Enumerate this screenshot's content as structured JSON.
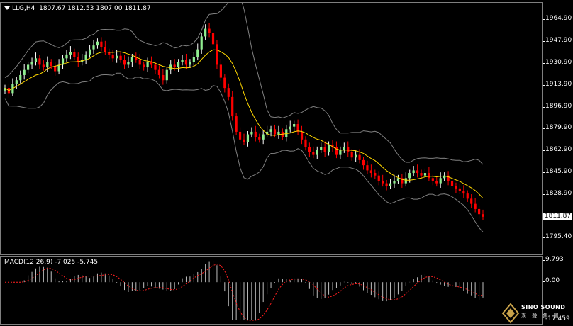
{
  "chart_header": {
    "symbol_tf": "LLG,H4",
    "ohlc": "1807.67 1812.53 1807.00 1811.87"
  },
  "macd_header": {
    "label": "MACD(12,26,9) -7.025 -5.745"
  },
  "price_axis": [
    "1964.90",
    "1947.90",
    "1930.90",
    "1913.90",
    "1896.90",
    "1879.90",
    "1862.90",
    "1845.90",
    "1828.90",
    "1811.87",
    "1795.40"
  ],
  "current_price": "1811.87",
  "macd_axis": [
    "9.793",
    "0.00",
    "-17.459"
  ],
  "logo": {
    "title": "SINO SOUND",
    "subtitle": "漢 聲 集 團"
  },
  "colors": {
    "bull": "#ffffff",
    "bear": "#ff0000",
    "bull_body": "#90ee90",
    "bear_body": "#ff0000",
    "ma": "#ffd700",
    "band": "#808080",
    "signal": "#ff2020"
  },
  "chart_data": {
    "type": "candlestick",
    "symbol": "LLG",
    "timeframe": "H4",
    "ylim": [
      1795.4,
      1970
    ],
    "closes": [
      1912,
      1908,
      1915,
      1918,
      1922,
      1926,
      1930,
      1932,
      1935,
      1930,
      1928,
      1932,
      1929,
      1925,
      1930,
      1935,
      1938,
      1940,
      1936,
      1932,
      1934,
      1938,
      1942,
      1945,
      1948,
      1944,
      1940,
      1938,
      1935,
      1937,
      1934,
      1930,
      1932,
      1936,
      1934,
      1930,
      1928,
      1932,
      1930,
      1926,
      1922,
      1918,
      1926,
      1930,
      1928,
      1932,
      1934,
      1930,
      1932,
      1936,
      1942,
      1952,
      1958,
      1955,
      1946,
      1930,
      1920,
      1912,
      1905,
      1890,
      1878,
      1872,
      1870,
      1876,
      1878,
      1874,
      1872,
      1876,
      1878,
      1880,
      1876,
      1878,
      1874,
      1880,
      1882,
      1884,
      1878,
      1872,
      1866,
      1862,
      1860,
      1864,
      1866,
      1862,
      1868,
      1866,
      1860,
      1864,
      1866,
      1862,
      1858,
      1860,
      1856,
      1852,
      1848,
      1846,
      1844,
      1840,
      1838,
      1836,
      1838,
      1840,
      1842,
      1838,
      1842,
      1846,
      1848,
      1846,
      1844,
      1846,
      1842,
      1840,
      1838,
      1842,
      1844,
      1840,
      1836,
      1834,
      1832,
      1830,
      1826,
      1822,
      1818,
      1814,
      1812
    ],
    "macd_signal_last": -5.745,
    "macd_main_last": -7.025,
    "macd_range": [
      -17.459,
      9.793
    ]
  }
}
